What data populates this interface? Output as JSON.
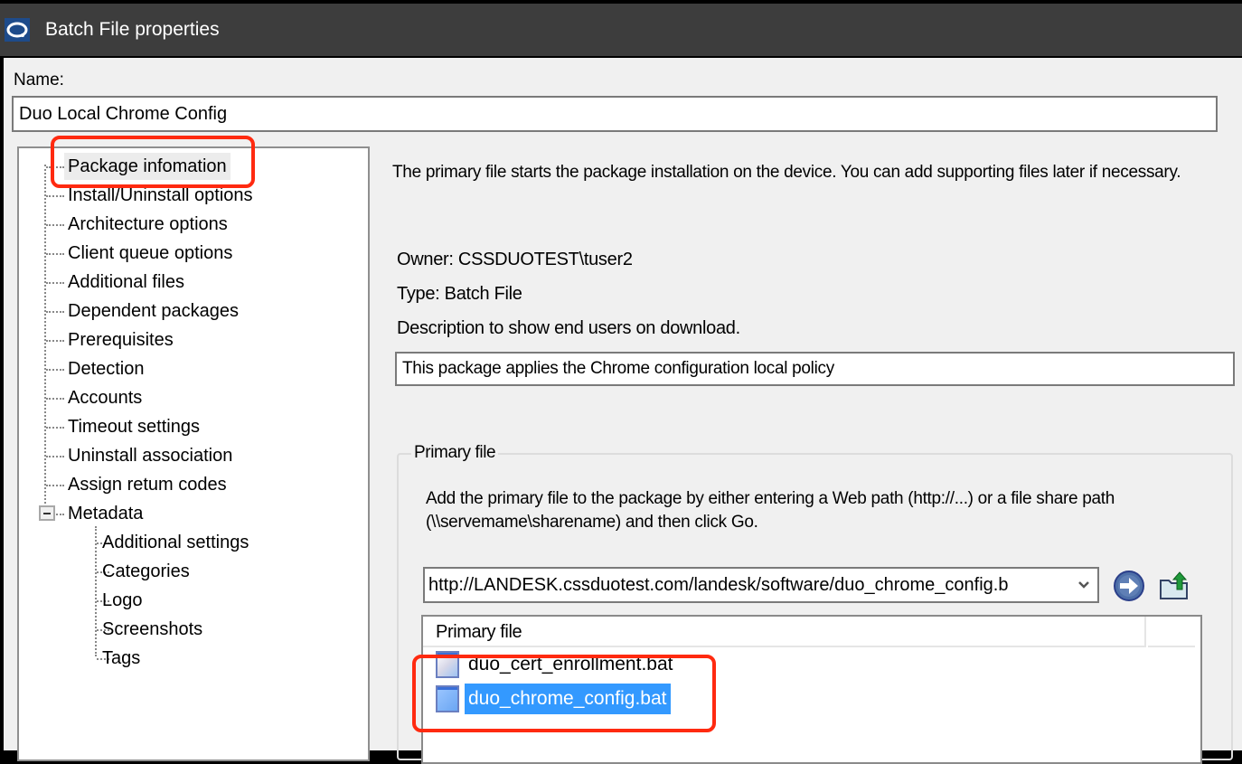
{
  "window": {
    "title": "Batch File properties",
    "icon": "landesk-app-icon"
  },
  "name_field": {
    "label": "Name:",
    "value": "Duo Local Chrome Config"
  },
  "tree": {
    "items": [
      {
        "label": "Package infomation",
        "selected": true,
        "level": 0
      },
      {
        "label": "Install/Uninstall options",
        "level": 0
      },
      {
        "label": "Architecture options",
        "level": 0
      },
      {
        "label": "Client queue options",
        "level": 0
      },
      {
        "label": "Additional files",
        "level": 0
      },
      {
        "label": "Dependent packages",
        "level": 0
      },
      {
        "label": "Prerequisites",
        "level": 0
      },
      {
        "label": "Detection",
        "level": 0
      },
      {
        "label": "Accounts",
        "level": 0
      },
      {
        "label": "Timeout settings",
        "level": 0
      },
      {
        "label": "Uninstall association",
        "level": 0
      },
      {
        "label": "Assign retum codes",
        "level": 0
      },
      {
        "label": "Metadata",
        "level": 0,
        "expanded": true
      },
      {
        "label": "Additional settings",
        "level": 1
      },
      {
        "label": "Categories",
        "level": 1
      },
      {
        "label": "Logo",
        "level": 1
      },
      {
        "label": "Screenshots",
        "level": 1
      },
      {
        "label": "Tags",
        "level": 1
      }
    ]
  },
  "main": {
    "intro": "The primary file starts the package installation on the device. You can add supporting files later if necessary.",
    "owner": "Owner: CSSDUOTEST\\tuser2",
    "type": "Type:  Batch File",
    "description_label": "Description to show end users on download.",
    "description_value": "This package applies the Chrome configuration local policy",
    "primary_file_group": {
      "label": "Primary file",
      "help": "Add the primary file to the package by either entering a Web path (http://...) or a file share path (\\\\servemame\\sharename) and then click Go.",
      "url_value": "http://LANDESK.cssduotest.com/landesk/software/duo_chrome_config.b",
      "go_icon": "go-arrow-icon",
      "upload_icon": "upload-folder-icon",
      "list_header": "Primary file",
      "files": [
        {
          "name": "duo_cert_enrollment.bat",
          "selected": false
        },
        {
          "name": "duo_chrome_config.bat",
          "selected": true
        }
      ]
    }
  },
  "annotations": {
    "highlight_color": "#ff2a10"
  },
  "colors": {
    "titlebar": "#3d3d3d",
    "window_bg": "#f0f0f0",
    "selection": "#3399ff"
  }
}
